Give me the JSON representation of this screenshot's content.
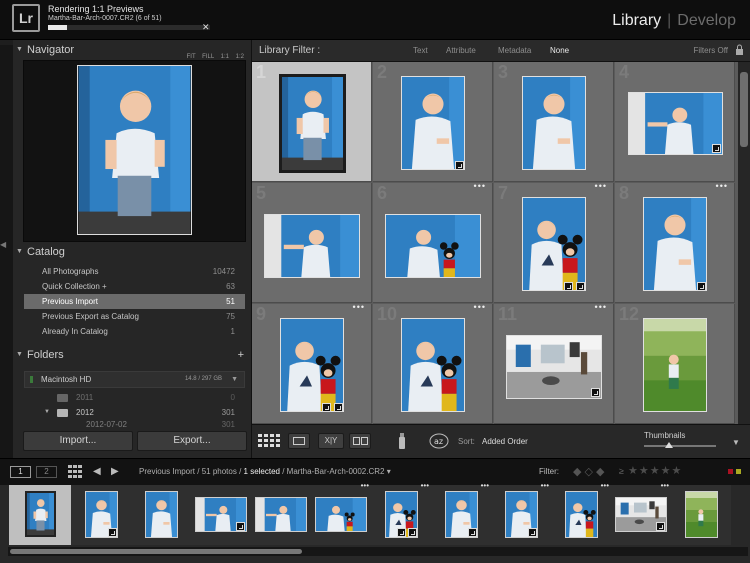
{
  "app": {
    "logo": "Lr",
    "modules": [
      "Library",
      "Develop"
    ],
    "active_module": "Library"
  },
  "progress": {
    "task": "Rendering 1:1 Previews",
    "file": "Martha-Bar-Arch-0007.CR2 (6 of 51)",
    "fraction": 0.12
  },
  "navigator": {
    "title": "Navigator",
    "options": [
      "FIT",
      "FILL",
      "1:1",
      "1:2"
    ]
  },
  "catalog": {
    "title": "Catalog",
    "items": [
      {
        "label": "All Photographs",
        "count": "10472"
      },
      {
        "label": "Quick Collection +",
        "count": "63"
      },
      {
        "label": "Previous Import",
        "count": "51"
      },
      {
        "label": "Previous Export as Catalog",
        "count": "75"
      },
      {
        "label": "Already In Catalog",
        "count": "1"
      }
    ],
    "selected_index": 2
  },
  "folders": {
    "title": "Folders",
    "add": "+",
    "volume": {
      "name": "Macintosh HD",
      "size": "14.8 / 297 GB"
    },
    "items": [
      {
        "label": "2011",
        "count": "0"
      },
      {
        "label": "2012",
        "count": "301"
      },
      {
        "label": "2012-07-02",
        "count": "301"
      }
    ]
  },
  "buttons": {
    "import": "Import...",
    "export": "Export..."
  },
  "filter": {
    "label": "Library Filter :",
    "options": [
      "Text",
      "Attribute",
      "Metadata",
      "None"
    ],
    "active": "None",
    "filters_off": "Filters Off"
  },
  "grid": {
    "indices": [
      "1",
      "2",
      "3",
      "4",
      "5",
      "6",
      "7",
      "8",
      "9",
      "10",
      "11",
      "12"
    ],
    "more": "•••"
  },
  "toolbar": {
    "sort_label": "Sort:",
    "sort_value": "Added Order",
    "thumbnails_label": "Thumbnails",
    "thumbnail_size": 0.35
  },
  "filmstrip": {
    "views": [
      "1",
      "2"
    ],
    "source": "Previous Import",
    "photos": "51 photos",
    "selected": "1 selected",
    "file": "Martha-Bar-Arch-0002.CR2",
    "filter_label": "Filter:",
    "stars": "★★★★★"
  },
  "colors": {
    "accent": "#e9e9e9",
    "selected_row": "#6b6b6b",
    "grid_bg": "#5b5b5b",
    "wall_blue": "#2f7fc2"
  }
}
